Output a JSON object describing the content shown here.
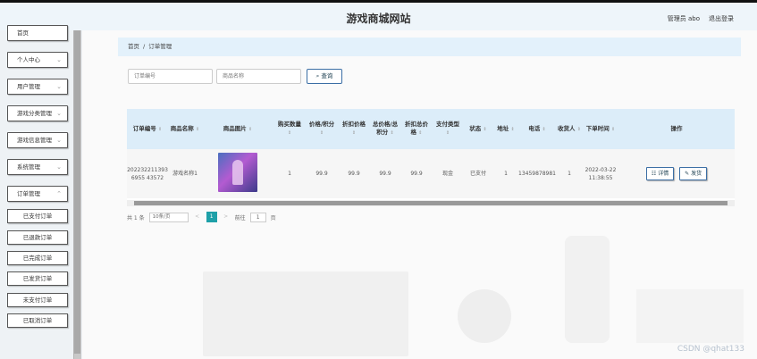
{
  "header": {
    "title": "游戏商城网站",
    "admin_label": "管理员 abo",
    "logout_label": "退出登录"
  },
  "sidebar": {
    "items": [
      {
        "label": "首页"
      },
      {
        "label": "个人中心"
      },
      {
        "label": "用户管理"
      },
      {
        "label": "游戏分类管理"
      },
      {
        "label": "游戏信息管理"
      },
      {
        "label": "系统管理"
      },
      {
        "label": "订单管理"
      }
    ],
    "subitems": [
      {
        "label": "已支付订单"
      },
      {
        "label": "已退款订单"
      },
      {
        "label": "已完成订单"
      },
      {
        "label": "已发货订单"
      },
      {
        "label": "未支付订单"
      },
      {
        "label": "已取消订单"
      }
    ]
  },
  "breadcrumb": {
    "home": "首页",
    "separator": "/",
    "current": "订单管理"
  },
  "search": {
    "order_no_placeholder": "订单编号",
    "product_name_placeholder": "商品名称",
    "search_button": "查询"
  },
  "table": {
    "headers": [
      "订单编号",
      "商品名称",
      "商品图片",
      "购买数量",
      "价格/积分",
      "折扣价格",
      "总价格/总积分",
      "折扣总价格",
      "支付类型",
      "状态",
      "地址",
      "电话",
      "收货人",
      "下单时间",
      "操作"
    ],
    "rows": [
      {
        "order_no": "2022322113936955 43572",
        "product_name": "游戏名称1",
        "quantity": "1",
        "price": "99.9",
        "discount_price": "99.9",
        "total_price": "99.9",
        "discount_total": "99.9",
        "pay_type": "现金",
        "status": "已支付",
        "address": "1",
        "phone": "13459878981",
        "receiver": "1",
        "order_time": "2022-03-22 11:38:55",
        "detail_label": "详情",
        "ship_label": "发货"
      }
    ]
  },
  "pager": {
    "total": "共 1 条",
    "page_size": "10条/页",
    "prev": "<",
    "current_page": "1",
    "next": ">",
    "goto_label": "前往",
    "goto_value": "1",
    "page_unit": "页"
  },
  "watermark": "CSDN @qhat133",
  "colors": {
    "accent": "#1ea0a8",
    "header_bg": "#eef5fa",
    "table_header_bg": "#dcedf9"
  }
}
